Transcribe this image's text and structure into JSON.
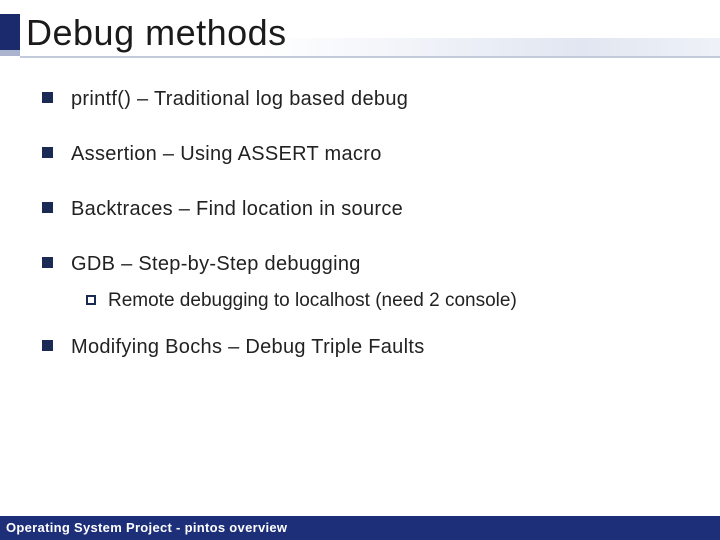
{
  "title": "Debug methods",
  "bullets": {
    "b0": "printf() – Traditional log based debug",
    "b1": "Assertion – Using ASSERT macro",
    "b2": "Backtraces – Find location in source",
    "b3": "GDB – Step-by-Step debugging",
    "b3_sub": "Remote debugging to localhost (need 2 console)",
    "b4": "Modifying Bochs – Debug Triple Faults"
  },
  "footer": "Operating System Project - pintos overview"
}
